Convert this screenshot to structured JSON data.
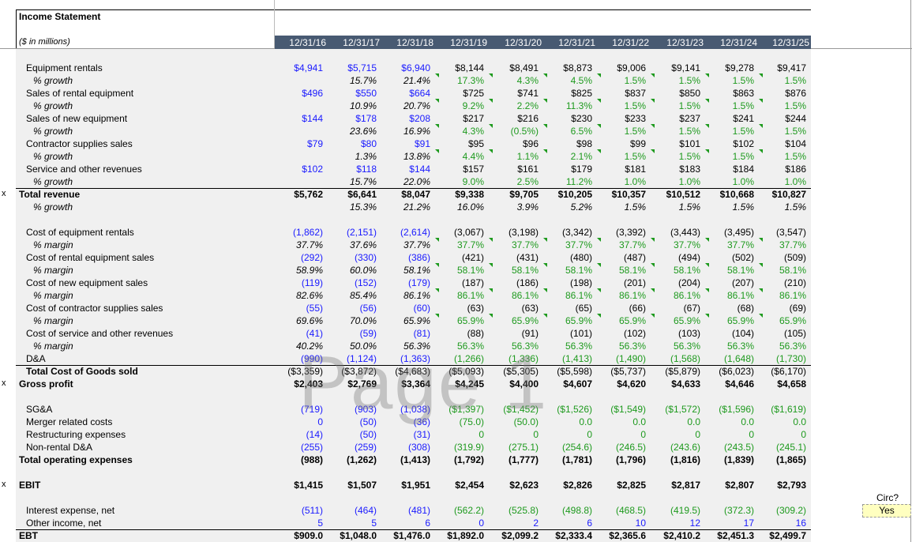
{
  "title": "Income Statement",
  "units": "($ in millions)",
  "years": [
    "12/31/16",
    "12/31/17",
    "12/31/18",
    "12/31/19",
    "12/31/20",
    "12/31/21",
    "12/31/22",
    "12/31/23",
    "12/31/24",
    "12/31/25"
  ],
  "watermark": "Page 1",
  "circ": {
    "label": "Circ?",
    "value": "Yes"
  },
  "colors": {
    "header": "#485a72",
    "input": "#1a1aff",
    "projection": "#1e9a1e",
    "background": "#f0f0f0"
  },
  "rows": [
    {
      "label": "Equipment rentals",
      "style": "ind",
      "vals": [
        "$4,941",
        "$5,715",
        "$6,940",
        "$8,144",
        "$8,491",
        "$8,873",
        "$9,006",
        "$9,141",
        "$9,278",
        "$9,417"
      ],
      "colors": "bbbkkkkkkk"
    },
    {
      "label": "% growth",
      "style": "sub",
      "vals": [
        "",
        "15.7%",
        "21.4%",
        "17.3%",
        "4.3%",
        "4.5%",
        "1.5%",
        "1.5%",
        "1.5%",
        "1.5%"
      ],
      "colors": "kkkgggggggg",
      "it": "kkk",
      "tri": true
    },
    {
      "label": "Sales of rental equipment",
      "style": "ind",
      "vals": [
        "$496",
        "$550",
        "$664",
        "$725",
        "$741",
        "$825",
        "$837",
        "$850",
        "$863",
        "$876"
      ],
      "colors": "bbbkkkkkkk"
    },
    {
      "label": "% growth",
      "style": "sub",
      "vals": [
        "",
        "10.9%",
        "20.7%",
        "9.2%",
        "2.2%",
        "11.3%",
        "1.5%",
        "1.5%",
        "1.5%",
        "1.5%"
      ],
      "colors": "kkkggggggg",
      "it": "kkk",
      "tri": true
    },
    {
      "label": "Sales of new equipment",
      "style": "ind",
      "vals": [
        "$144",
        "$178",
        "$208",
        "$217",
        "$216",
        "$230",
        "$233",
        "$237",
        "$241",
        "$244"
      ],
      "colors": "bbbkkkkkkk"
    },
    {
      "label": "% growth",
      "style": "sub",
      "vals": [
        "",
        "23.6%",
        "16.9%",
        "4.3%",
        "(0.5%)",
        "6.5%",
        "1.5%",
        "1.5%",
        "1.5%",
        "1.5%"
      ],
      "colors": "kkkggggggg",
      "it": "kkk",
      "tri": true
    },
    {
      "label": "Contractor supplies sales",
      "style": "ind",
      "vals": [
        "$79",
        "$80",
        "$91",
        "$95",
        "$96",
        "$98",
        "$99",
        "$101",
        "$102",
        "$104"
      ],
      "colors": "bbbkkkkkkk"
    },
    {
      "label": "% growth",
      "style": "sub",
      "vals": [
        "",
        "1.3%",
        "13.8%",
        "4.4%",
        "1.1%",
        "2.1%",
        "1.5%",
        "1.5%",
        "1.5%",
        "1.5%"
      ],
      "colors": "kkkggggggg",
      "it": "kkk",
      "tri": true
    },
    {
      "label": "Service and other revenues",
      "style": "ind",
      "vals": [
        "$102",
        "$118",
        "$144",
        "$157",
        "$161",
        "$179",
        "$181",
        "$183",
        "$184",
        "$186"
      ],
      "colors": "bbbkkkkkkk"
    },
    {
      "label": "% growth",
      "style": "sub",
      "vals": [
        "",
        "15.7%",
        "22.0%",
        "9.0%",
        "2.5%",
        "11.2%",
        "1.0%",
        "1.0%",
        "1.0%",
        "1.0%"
      ],
      "colors": "kkkggggggg",
      "it": "kkk",
      "tri": false
    },
    {
      "label": "Total revenue",
      "style": "bold",
      "x": "x",
      "vals": [
        "$5,762",
        "$6,641",
        "$8,047",
        "$9,338",
        "$9,705",
        "$10,205",
        "$10,357",
        "$10,512",
        "$10,668",
        "$10,827"
      ],
      "colors": "kkkkkkkkkk",
      "bold": true,
      "topline": true
    },
    {
      "label": "% growth",
      "style": "sub",
      "vals": [
        "",
        "15.3%",
        "21.2%",
        "16.0%",
        "3.9%",
        "5.2%",
        "1.5%",
        "1.5%",
        "1.5%",
        "1.5%"
      ],
      "colors": "kkkkkkkkkk",
      "italicAll": true
    },
    {
      "label": "",
      "style": "ind",
      "vals": [
        "",
        "",
        "",
        "",
        "",
        "",
        "",
        "",
        "",
        ""
      ],
      "colors": "kkkkkkkkkk"
    },
    {
      "label": "Cost of equipment rentals",
      "style": "ind",
      "vals": [
        "(1,862)",
        "(2,151)",
        "(2,614)",
        "(3,067)",
        "(3,198)",
        "(3,342)",
        "(3,392)",
        "(3,443)",
        "(3,495)",
        "(3,547)"
      ],
      "colors": "bbbkkkkkkk"
    },
    {
      "label": "% margin",
      "style": "sub",
      "vals": [
        "37.7%",
        "37.6%",
        "37.7%",
        "37.7%",
        "37.7%",
        "37.7%",
        "37.7%",
        "37.7%",
        "37.7%",
        "37.7%"
      ],
      "colors": "kkkggggggg",
      "it": "kkk",
      "tri": true
    },
    {
      "label": "Cost of rental equipment sales",
      "style": "ind",
      "vals": [
        "(292)",
        "(330)",
        "(386)",
        "(421)",
        "(431)",
        "(480)",
        "(487)",
        "(494)",
        "(502)",
        "(509)"
      ],
      "colors": "bbbkkkkkkk"
    },
    {
      "label": "% margin",
      "style": "sub",
      "vals": [
        "58.9%",
        "60.0%",
        "58.1%",
        "58.1%",
        "58.1%",
        "58.1%",
        "58.1%",
        "58.1%",
        "58.1%",
        "58.1%"
      ],
      "colors": "kkkggggggg",
      "it": "kkk",
      "tri": true
    },
    {
      "label": "Cost of new equipment sales",
      "style": "ind",
      "vals": [
        "(119)",
        "(152)",
        "(179)",
        "(187)",
        "(186)",
        "(198)",
        "(201)",
        "(204)",
        "(207)",
        "(210)"
      ],
      "colors": "bbbkkkkkkk"
    },
    {
      "label": "% margin",
      "style": "sub",
      "vals": [
        "82.6%",
        "85.4%",
        "86.1%",
        "86.1%",
        "86.1%",
        "86.1%",
        "86.1%",
        "86.1%",
        "86.1%",
        "86.1%"
      ],
      "colors": "kkkggggggg",
      "it": "kkk",
      "tri": true
    },
    {
      "label": "Cost of contractor supplies sales",
      "style": "ind",
      "vals": [
        "(55)",
        "(56)",
        "(60)",
        "(63)",
        "(63)",
        "(65)",
        "(66)",
        "(67)",
        "(68)",
        "(69)"
      ],
      "colors": "bbbkkkkkkk"
    },
    {
      "label": "% margin",
      "style": "sub",
      "vals": [
        "69.6%",
        "70.0%",
        "65.9%",
        "65.9%",
        "65.9%",
        "65.9%",
        "65.9%",
        "65.9%",
        "65.9%",
        "65.9%"
      ],
      "colors": "kkkggggggg",
      "it": "kkk",
      "tri": true
    },
    {
      "label": "Cost of service and other revenues",
      "style": "ind",
      "vals": [
        "(41)",
        "(59)",
        "(81)",
        "(88)",
        "(91)",
        "(101)",
        "(102)",
        "(103)",
        "(104)",
        "(105)"
      ],
      "colors": "bbbkkkkkkk"
    },
    {
      "label": "% margin",
      "style": "sub",
      "vals": [
        "40.2%",
        "50.0%",
        "56.3%",
        "56.3%",
        "56.3%",
        "56.3%",
        "56.3%",
        "56.3%",
        "56.3%",
        "56.3%"
      ],
      "colors": "kkkggggggg",
      "it": "kkk",
      "tri": false
    },
    {
      "label": "D&A",
      "style": "ind",
      "vals": [
        "(990)",
        "(1,124)",
        "(1,363)",
        "(1,266)",
        "(1,336)",
        "(1,413)",
        "(1,490)",
        "(1,568)",
        "(1,648)",
        "(1,730)"
      ],
      "colors": "bbbggggggg"
    },
    {
      "label": "Total Cost of Goods sold",
      "style": "ind",
      "boldLabel": true,
      "vals": [
        "($3,359)",
        "($3,872)",
        "($4,683)",
        "($5,093)",
        "($5,305)",
        "($5,598)",
        "($5,737)",
        "($5,879)",
        "($6,023)",
        "($6,170)"
      ],
      "colors": "kkkkkkkkkk",
      "topline": true
    },
    {
      "label": "Gross profit",
      "style": "bold",
      "x": "x",
      "vals": [
        "$2,403",
        "$2,769",
        "$3,364",
        "$4,245",
        "$4,400",
        "$4,607",
        "$4,620",
        "$4,633",
        "$4,646",
        "$4,658"
      ],
      "colors": "kkkkkkkkkk",
      "bold": true
    },
    {
      "label": "",
      "style": "ind",
      "vals": [
        "",
        "",
        "",
        "",
        "",
        "",
        "",
        "",
        "",
        ""
      ],
      "colors": "kkkkkkkkkk"
    },
    {
      "label": "SG&A",
      "style": "ind",
      "vals": [
        "(719)",
        "(903)",
        "(1,038)",
        "($1,397)",
        "($1,452)",
        "($1,526)",
        "($1,549)",
        "($1,572)",
        "($1,596)",
        "($1,619)"
      ],
      "colors": "bbbggggggg"
    },
    {
      "label": "Merger related costs",
      "style": "ind",
      "vals": [
        "0",
        "(50)",
        "(36)",
        "(75.0)",
        "(50.0)",
        "0.0",
        "0.0",
        "0.0",
        "0.0",
        "0.0"
      ],
      "colors": "bbbggggggg"
    },
    {
      "label": "Restructuring expenses",
      "style": "ind",
      "vals": [
        "(14)",
        "(50)",
        "(31)",
        "0",
        "0",
        "0",
        "0",
        "0",
        "0",
        "0"
      ],
      "colors": "bbbggggggg"
    },
    {
      "label": "Non-rental D&A",
      "style": "ind",
      "vals": [
        "(255)",
        "(259)",
        "(308)",
        "(319.9)",
        "(275.1)",
        "(254.6)",
        "(246.5)",
        "(243.6)",
        "(243.5)",
        "(245.1)"
      ],
      "colors": "bbbggggggg"
    },
    {
      "label": "Total operating expenses",
      "style": "bold",
      "vals": [
        "(988)",
        "(1,262)",
        "(1,413)",
        "(1,792)",
        "(1,777)",
        "(1,781)",
        "(1,796)",
        "(1,816)",
        "(1,839)",
        "(1,865)"
      ],
      "colors": "kkkkkkkkkk",
      "bold": true
    },
    {
      "label": "",
      "style": "ind",
      "vals": [
        "",
        "",
        "",
        "",
        "",
        "",
        "",
        "",
        "",
        ""
      ],
      "colors": "kkkkkkkkkk"
    },
    {
      "label": "EBIT",
      "style": "bold",
      "x": "x",
      "vals": [
        "$1,415",
        "$1,507",
        "$1,951",
        "$2,454",
        "$2,623",
        "$2,826",
        "$2,825",
        "$2,817",
        "$2,807",
        "$2,793"
      ],
      "colors": "kkkkkkkkkk",
      "bold": true
    },
    {
      "label": "",
      "style": "ind",
      "vals": [
        "",
        "",
        "",
        "",
        "",
        "",
        "",
        "",
        "",
        ""
      ],
      "colors": "kkkkkkkkkk"
    },
    {
      "label": "Interest expense, net",
      "style": "ind",
      "vals": [
        "(511)",
        "(464)",
        "(481)",
        "(562.2)",
        "(525.8)",
        "(498.8)",
        "(468.5)",
        "(419.5)",
        "(372.3)",
        "(309.2)"
      ],
      "colors": "bbbggggggg"
    },
    {
      "label": "Other income, net",
      "style": "ind",
      "vals": [
        "5",
        "5",
        "6",
        "0",
        "2",
        "6",
        "10",
        "12",
        "17",
        "16"
      ],
      "colors": "bbbbbbbbbb"
    },
    {
      "label": "EBT",
      "style": "bold",
      "vals": [
        "$909.0",
        "$1,048.0",
        "$1,476.0",
        "$1,892.0",
        "$2,099.2",
        "$2,333.4",
        "$2,365.6",
        "$2,410.2",
        "$2,451.3",
        "$2,499.7"
      ],
      "colors": "kkkkkkkkkk",
      "bold": true,
      "topline": true
    }
  ]
}
